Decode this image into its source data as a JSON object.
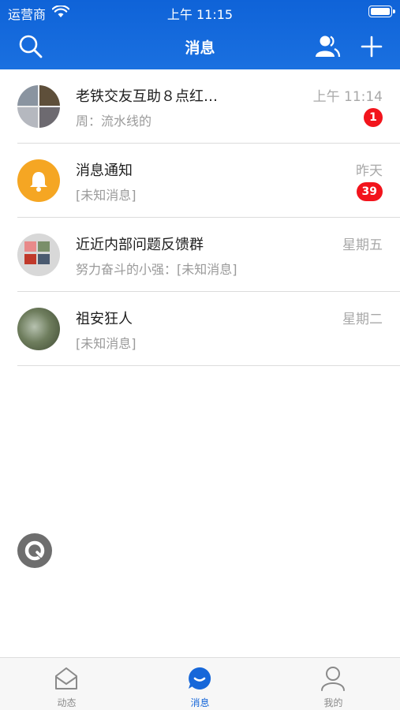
{
  "status_bar": {
    "carrier": "运营商",
    "time": "上午 11:15"
  },
  "nav": {
    "title": "消息"
  },
  "conversations": [
    {
      "title": "老铁交友互助８点红…",
      "subtitle": "周：流水线的",
      "time": "上午 11:14",
      "badge": "1"
    },
    {
      "title": "消息通知",
      "subtitle": "[未知消息]",
      "time": "昨天",
      "badge": "39"
    },
    {
      "title": "近近内部问题反馈群",
      "subtitle": "努力奋斗的小强：[未知消息]",
      "time": "星期五"
    },
    {
      "title": "祖安狂人",
      "subtitle": "[未知消息]",
      "time": "星期二"
    }
  ],
  "tabbar": {
    "items": [
      {
        "label": "动态",
        "icon": "home-icon"
      },
      {
        "label": "消息",
        "icon": "chat-bubble-icon",
        "active": true
      },
      {
        "label": "我的",
        "icon": "person-icon"
      }
    ]
  },
  "colors": {
    "primary": "#1667d9",
    "badge": "#f2141c",
    "notification_avatar": "#f5a623"
  }
}
